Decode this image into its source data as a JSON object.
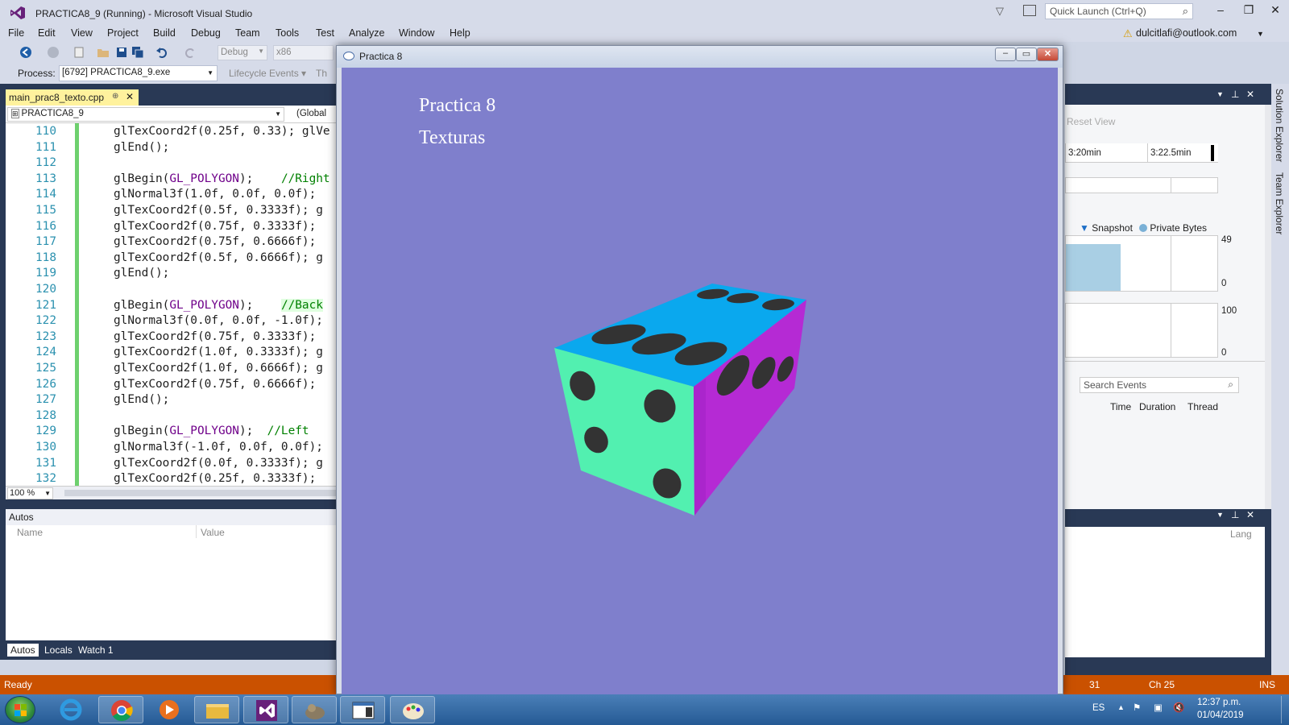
{
  "vs": {
    "title": "PRACTICA8_9 (Running) - Microsoft Visual Studio",
    "quick_launch_placeholder": "Quick Launch (Ctrl+Q)",
    "account": "dulcitlafi@outlook.com",
    "menu": [
      "File",
      "Edit",
      "View",
      "Project",
      "Build",
      "Debug",
      "Team",
      "Tools",
      "Test",
      "Analyze",
      "Window",
      "Help"
    ]
  },
  "toolbar": {
    "config": "Debug",
    "platform": "x86",
    "process_label": "Process:",
    "process_value": "[6792] PRACTICA8_9.exe",
    "lifecycle": "Lifecycle Events",
    "thread_fragment": "Th"
  },
  "editor": {
    "tab_label": "main_prac8_texto.cpp",
    "project_combo": "PRACTICA8_9",
    "scope_combo": "(Global",
    "zoom": "100 %",
    "lines": [
      {
        "n": "110",
        "segs": [
          [
            "t",
            "glTexCoord2f(0.25f, 0.33); glVe"
          ]
        ]
      },
      {
        "n": "111",
        "segs": [
          [
            "t",
            "glEnd();"
          ]
        ]
      },
      {
        "n": "112",
        "segs": []
      },
      {
        "n": "113",
        "segs": [
          [
            "t",
            "glBegin("
          ],
          [
            "k",
            "GL_POLYGON"
          ],
          [
            "t",
            ");    "
          ],
          [
            "c",
            "//Right"
          ]
        ]
      },
      {
        "n": "114",
        "segs": [
          [
            "t",
            "glNormal3f(1.0f, 0.0f, 0.0f);"
          ]
        ]
      },
      {
        "n": "115",
        "segs": [
          [
            "t",
            "glTexCoord2f(0.5f, 0.3333f); g"
          ]
        ]
      },
      {
        "n": "116",
        "segs": [
          [
            "t",
            "glTexCoord2f(0.75f, 0.3333f); "
          ]
        ]
      },
      {
        "n": "117",
        "segs": [
          [
            "t",
            "glTexCoord2f(0.75f, 0.6666f); "
          ]
        ]
      },
      {
        "n": "118",
        "segs": [
          [
            "t",
            "glTexCoord2f(0.5f, 0.6666f); g"
          ]
        ]
      },
      {
        "n": "119",
        "segs": [
          [
            "t",
            "glEnd();"
          ]
        ]
      },
      {
        "n": "120",
        "segs": []
      },
      {
        "n": "121",
        "segs": [
          [
            "t",
            "glBegin("
          ],
          [
            "k",
            "GL_POLYGON"
          ],
          [
            "t",
            ");    "
          ],
          [
            "h",
            "//Back"
          ]
        ]
      },
      {
        "n": "122",
        "segs": [
          [
            "t",
            "glNormal3f(0.0f, 0.0f, -1.0f);"
          ]
        ]
      },
      {
        "n": "123",
        "segs": [
          [
            "t",
            "glTexCoord2f(0.75f, 0.3333f); "
          ]
        ]
      },
      {
        "n": "124",
        "segs": [
          [
            "t",
            "glTexCoord2f(1.0f, 0.3333f); g"
          ]
        ]
      },
      {
        "n": "125",
        "segs": [
          [
            "t",
            "glTexCoord2f(1.0f, 0.6666f); g"
          ]
        ]
      },
      {
        "n": "126",
        "segs": [
          [
            "t",
            "glTexCoord2f(0.75f, 0.6666f); "
          ]
        ]
      },
      {
        "n": "127",
        "segs": [
          [
            "t",
            "glEnd();"
          ]
        ]
      },
      {
        "n": "128",
        "segs": []
      },
      {
        "n": "129",
        "segs": [
          [
            "t",
            "glBegin("
          ],
          [
            "k",
            "GL_POLYGON"
          ],
          [
            "t",
            ");  "
          ],
          [
            "c",
            "//Left"
          ]
        ]
      },
      {
        "n": "130",
        "segs": [
          [
            "t",
            "glNormal3f(-1.0f, 0.0f, 0.0f);"
          ]
        ]
      },
      {
        "n": "131",
        "segs": [
          [
            "t",
            "glTexCoord2f(0.0f, 0.3333f); g"
          ]
        ]
      },
      {
        "n": "132",
        "segs": [
          [
            "t",
            "glTexCoord2f(0.25f, 0.3333f); "
          ]
        ]
      }
    ]
  },
  "autos": {
    "title": "Autos",
    "col_name": "Name",
    "col_value": "Value",
    "tabs": [
      "Autos",
      "Locals",
      "Watch 1"
    ]
  },
  "status": {
    "left": "Ready",
    "line_fragment": "31",
    "ch": "Ch 25",
    "mode": "INS"
  },
  "diagnostics": {
    "reset_view": "Reset View",
    "time1": "3:20min",
    "time2": "3:22.5min",
    "legend_snapshot": "Snapshot",
    "legend_private": "Private Bytes",
    "mem_max": "49",
    "mem_min": "0",
    "cpu_max": "100",
    "cpu_min": "0",
    "search_placeholder": "Search Events",
    "col_time": "Time",
    "col_duration": "Duration",
    "col_thread": "Thread",
    "lang_fragment": "Lang"
  },
  "side_tabs": [
    "Solution Explorer",
    "Team Explorer"
  ],
  "gl_window": {
    "title": "Practica 8",
    "text1": "Practica 8",
    "text2": "Texturas",
    "colors": {
      "background": "#7f7fcc",
      "top": "#0aa8ee",
      "front": "#52f0b0",
      "right": "#b52ad4",
      "pip": "#333333"
    }
  },
  "taskbar": {
    "lang": "ES",
    "time": "12:37 p.m.",
    "date": "01/04/2019"
  }
}
